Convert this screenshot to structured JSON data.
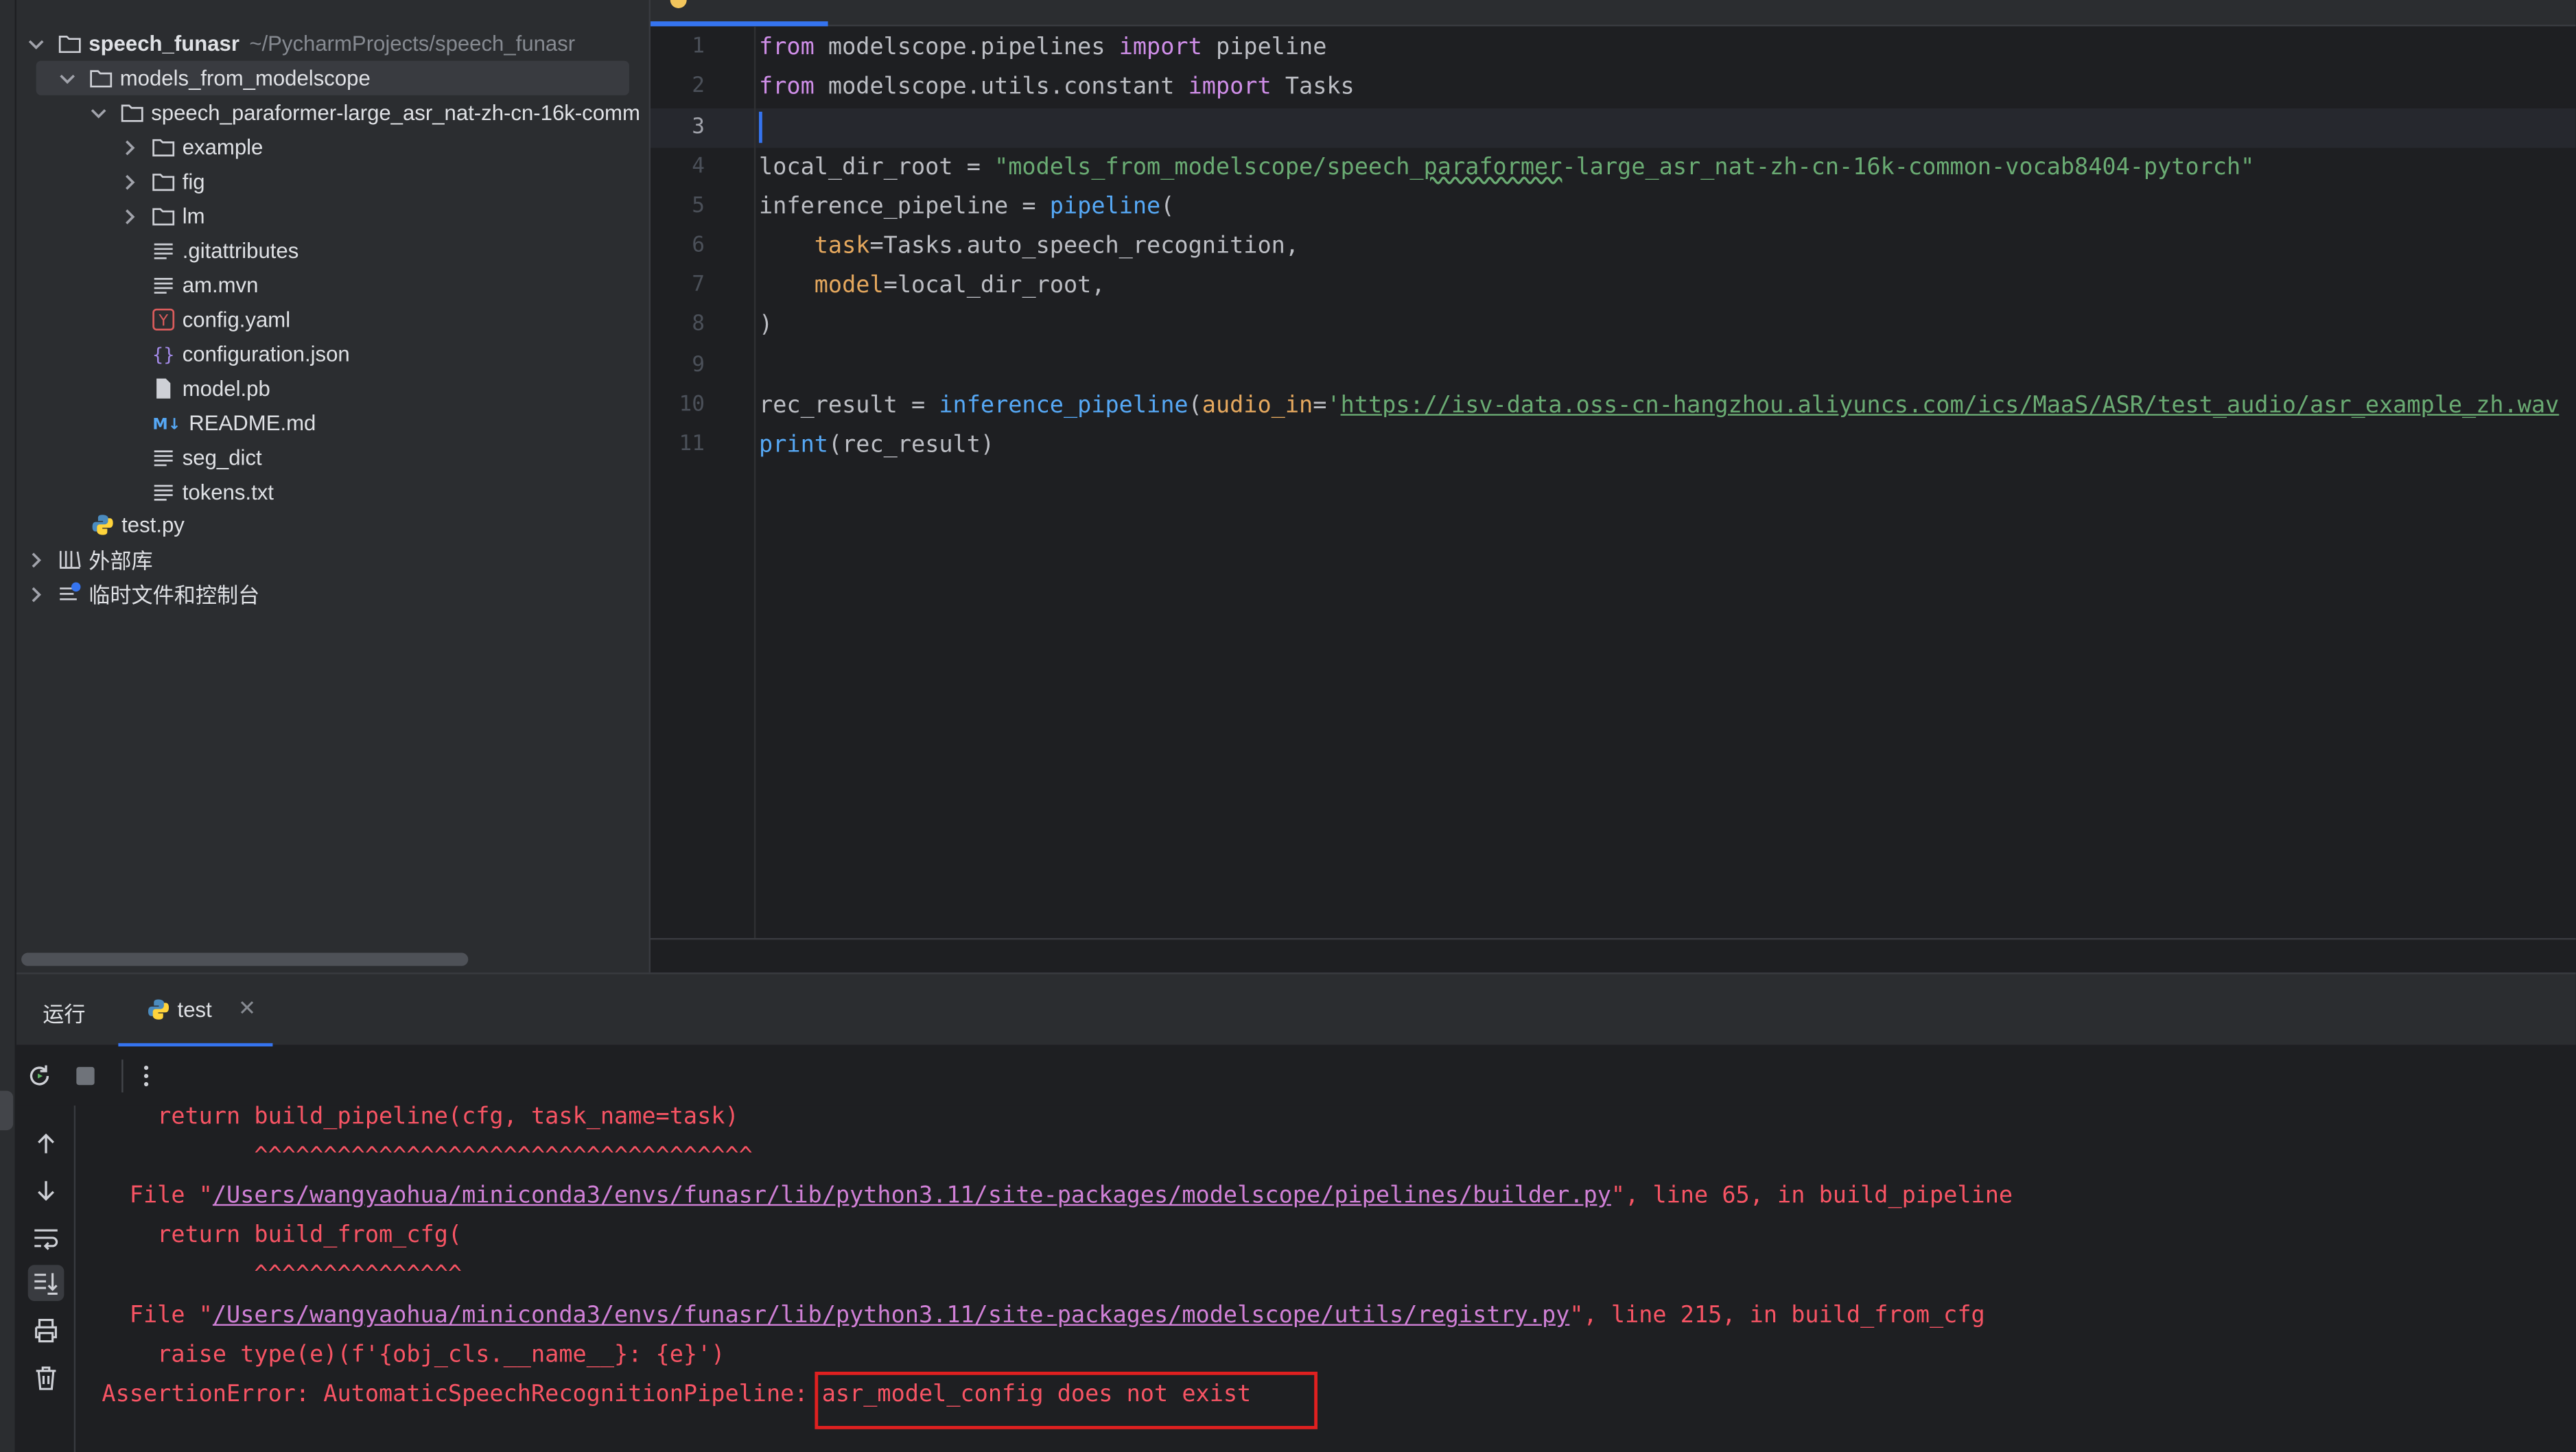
{
  "project_tree": {
    "root": {
      "name": "speech_funasr",
      "path": "~/PycharmProjects/speech_funasr"
    },
    "items": [
      {
        "label": "models_from_modelscope",
        "type": "folder"
      },
      {
        "label": "speech_paraformer-large_asr_nat-zh-cn-16k-comm",
        "type": "folder"
      },
      {
        "label": "example",
        "type": "folder"
      },
      {
        "label": "fig",
        "type": "folder"
      },
      {
        "label": "lm",
        "type": "folder"
      },
      {
        "label": ".gitattributes",
        "type": "text"
      },
      {
        "label": "am.mvn",
        "type": "text"
      },
      {
        "label": "config.yaml",
        "type": "yaml",
        "icon_letter": "Y"
      },
      {
        "label": "configuration.json",
        "type": "json",
        "icon_letter": "{}"
      },
      {
        "label": "model.pb",
        "type": "file"
      },
      {
        "label": "README.md",
        "type": "markdown",
        "icon_letter": "M↓"
      },
      {
        "label": "seg_dict",
        "type": "text"
      },
      {
        "label": "tokens.txt",
        "type": "text"
      },
      {
        "label": "test.py",
        "type": "python"
      },
      {
        "label": "外部库",
        "type": "library"
      },
      {
        "label": "临时文件和控制台",
        "type": "scratches"
      }
    ]
  },
  "editor": {
    "line_numbers": [
      "1",
      "2",
      "3",
      "4",
      "5",
      "6",
      "7",
      "8",
      "9",
      "10",
      "11"
    ],
    "current_line": "3",
    "code": {
      "l1": {
        "kw1": "from",
        "mod": " modelscope.pipelines ",
        "kw2": "import",
        "name": " pipeline"
      },
      "l2": {
        "kw1": "from",
        "mod": " modelscope.utils.constant ",
        "kw2": "import",
        "name": " Tasks"
      },
      "l4": {
        "var": "local_dir_root = ",
        "str_a": "\"models_from_modelscope/speech_",
        "str_typo": "paraformer",
        "str_b": "-large_asr_nat-zh-cn-16k-common-vocab8404-pytorch\""
      },
      "l5": {
        "var": "inference_pipeline = ",
        "fn": "pipeline",
        "paren": "("
      },
      "l6": {
        "indent": "    ",
        "param": "task",
        "rest": "=Tasks.auto_speech_recognition,"
      },
      "l7": {
        "indent": "    ",
        "param": "model",
        "rest": "=local_dir_root,"
      },
      "l8": {
        "text": ")"
      },
      "l10": {
        "var": "rec_result = ",
        "fn": "inference_pipeline",
        "paren": "(",
        "param": "audio_in",
        "eq": "=",
        "quote": "'",
        "url": "https://isv-data.oss-cn-hangzhou.aliyuncs.com/ics/MaaS/ASR/test_audio/asr_example_zh.wav"
      },
      "l11": {
        "fn": "print",
        "rest": "(rec_result)"
      }
    }
  },
  "run_panel": {
    "title": "运行",
    "tab_label": "test",
    "tab_close": "✕",
    "console": {
      "c1": "    return build_pipeline(cfg, task_name=task)",
      "c2": "           ^^^^^^^^^^^^^^^^^^^^^^^^^^^^^^^^^^^^",
      "c3_pre": "  File \"",
      "c3_link": "/Users/wangyaohua/miniconda3/envs/funasr/lib/python3.11/site-packages/modelscope/pipelines/builder.py",
      "c3_post": "\", line 65, in build_pipeline",
      "c4": "    return build_from_cfg(",
      "c5": "           ^^^^^^^^^^^^^^^",
      "c6_pre": "  File \"",
      "c6_link": "/Users/wangyaohua/miniconda3/envs/funasr/lib/python3.11/site-packages/modelscope/utils/registry.py",
      "c6_post": "\", line 215, in build_from_cfg",
      "c7": "    raise type(e)(f'{obj_cls.__name__}: {e}')",
      "c8_pre": "AssertionError: AutomaticSpeechRecognitionPipeline: ",
      "c8_msg": "asr_model_config does not exist"
    }
  },
  "colors": {
    "accent": "#3574f0",
    "error_text": "#f75464",
    "highlight_box": "#e02020",
    "keyword": "#cf8ee8",
    "string": "#6aab73",
    "function": "#56a8f5"
  }
}
